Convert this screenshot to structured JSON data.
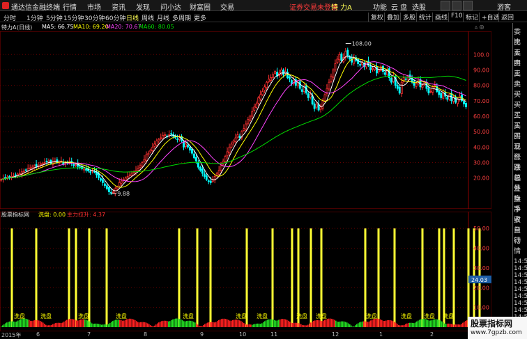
{
  "titlebar": {
    "app_name": "通达信金融终端",
    "menus": [
      "行情",
      "市场",
      "资讯",
      "发现",
      "问小达",
      "财富圈",
      "交易"
    ],
    "alert": "证券交易未登录",
    "stock_header": "特 力A",
    "right_menus": [
      "功能",
      "云 盘",
      "选股",
      "游客"
    ]
  },
  "periods": [
    "分时",
    "1分钟",
    "5分钟",
    "15分钟",
    "30分钟",
    "60分钟",
    "日线",
    "周线",
    "月线",
    "多周期",
    "更多"
  ],
  "active_period": "日线",
  "right_tools": [
    "复权",
    "叠加",
    "多股",
    "统计",
    "画线",
    "F10",
    "标记",
    "+自选",
    "返回"
  ],
  "info": {
    "stock": "特力A",
    "period_tag": "(日线)",
    "ma5": "MA5: 66.75",
    "ma10": "MA10: 69.20",
    "ma20": "MA20: 70.67",
    "ma60": "MA60: 80.05"
  },
  "price_axis": [
    "100.0",
    "90.00",
    "80.00",
    "70.00",
    "60.00",
    "50.00",
    "40.00",
    "30.00",
    "20.00"
  ],
  "high_label": "108.00",
  "low_label": "9.88",
  "indicator": {
    "name": "股票指标网",
    "line1": "洗盘: 0.00",
    "line2": "主力拉升: 4.37",
    "axis": [
      "50.00",
      "40.00",
      "30.00",
      "20.00",
      "10.00"
    ],
    "cursor_value": "24.03",
    "tag_text": "洗盘"
  },
  "x_axis": [
    "2015年",
    "6",
    "7",
    "8",
    "9",
    "10",
    "11",
    "12",
    "1",
    "2"
  ],
  "sidebar": {
    "labels": [
      "委比",
      "卖五",
      "卖四",
      "卖三",
      "卖二",
      "卖一",
      "买一",
      "买二",
      "买三",
      "买四",
      "买五",
      "现价",
      "涨跌",
      "涨幅",
      "总量",
      "外盘",
      "换手",
      "净资",
      "收益",
      "自动",
      "行情"
    ],
    "times": [
      "14:50",
      "14:50",
      "14:50",
      "14:50",
      "14:50",
      "14:50",
      "14:50",
      "14:50",
      "14:50",
      "14:50",
      "14:50"
    ]
  },
  "watermark": {
    "title": "股票指标网",
    "url": "www.7gpzb.com"
  },
  "colors": {
    "up": "#ff3030",
    "down": "#00ffff",
    "ma5": "#ffffff",
    "ma10": "#ffff00",
    "ma20": "#ff44ff",
    "ma60": "#00dd00",
    "grid": "#660000",
    "bar": "#ffff33"
  },
  "chart_data": {
    "type": "candlestick",
    "ylim": [
      0,
      115
    ],
    "closes": [
      19,
      19.5,
      20,
      20.5,
      20.8,
      21,
      21.2,
      21.8,
      22.5,
      23,
      24,
      24.5,
      25,
      26,
      26.5,
      27,
      28,
      27.5,
      28,
      29,
      29.5,
      30,
      30.5,
      31,
      29.5,
      30.5,
      31,
      30,
      30.5,
      31,
      29,
      29.5,
      30,
      30.5,
      29.5,
      28,
      28.5,
      27.5,
      27,
      26,
      25.8,
      25,
      24.5,
      24,
      25,
      24,
      22,
      20,
      18.5,
      17,
      15,
      13,
      11,
      10.5,
      10.9,
      13,
      14,
      17,
      18,
      19,
      20,
      21,
      22,
      23,
      24,
      25,
      26,
      28,
      30,
      32,
      35,
      36,
      38,
      40,
      42,
      44,
      45,
      46,
      47.5,
      48,
      47,
      48,
      48.5,
      47,
      46,
      45,
      46,
      44,
      40,
      42,
      40,
      38,
      36,
      33,
      31,
      27,
      25,
      23,
      21,
      19,
      18,
      17,
      19,
      21,
      23,
      25,
      28,
      31,
      34,
      37,
      40,
      42,
      44,
      46,
      48,
      46,
      50,
      52,
      55,
      58,
      60,
      63,
      66,
      68,
      72,
      74,
      76,
      79,
      82,
      84,
      85,
      87,
      89,
      86,
      88,
      90,
      87,
      89,
      85,
      84,
      81,
      83,
      80,
      82,
      78,
      76,
      79,
      75,
      72,
      74,
      68,
      65,
      68,
      64,
      66,
      70,
      74,
      78,
      82,
      86,
      90,
      94,
      97,
      100,
      96,
      98,
      102,
      99,
      97,
      95,
      98,
      96,
      94,
      93,
      95,
      92,
      95,
      93,
      90,
      91,
      92,
      88,
      90,
      92,
      89,
      87,
      90,
      85,
      82,
      86,
      80,
      78,
      75,
      82,
      85,
      84,
      86,
      85,
      82,
      80,
      81,
      83,
      79,
      80,
      82,
      78,
      75,
      76,
      79,
      80,
      76,
      74,
      72,
      75,
      73,
      71,
      74,
      70,
      72,
      69,
      71,
      73,
      70,
      68,
      66
    ]
  }
}
